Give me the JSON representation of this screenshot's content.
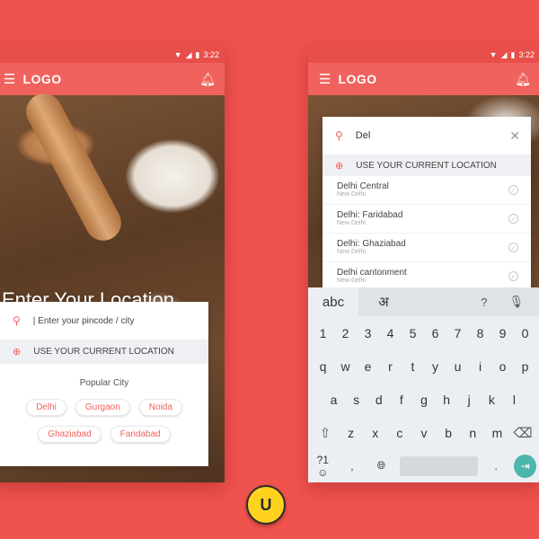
{
  "colors": {
    "background": "#f0524e",
    "appbar": "#f0625d",
    "accent": "#f0625d",
    "enter_key": "#4db6ac",
    "badge": "#ffd21f"
  },
  "status_bar": {
    "time": "3:22"
  },
  "app_bar": {
    "logo": "LOGO",
    "menu_icon": "hamburger-icon",
    "right_icon": "bell-icon"
  },
  "left_screen": {
    "hero_title": "Enter Your Location",
    "input_placeholder": "| Enter your pincode / city",
    "current_location_label": "USE YOUR CURRENT LOCATION",
    "popular_title": "Popular City",
    "cities": [
      "Delhi",
      "Gurgaon",
      "Noida",
      "Ghaziabad",
      "Faridabad"
    ]
  },
  "right_screen": {
    "search_value": "Del",
    "current_location_label": "USE YOUR CURRENT LOCATION",
    "suggestions": [
      {
        "name": "Delhi Central",
        "sub": "New Delhi"
      },
      {
        "name": "Delhi: Faridabad",
        "sub": "New Delhi"
      },
      {
        "name": "Delhi: Ghaziabad",
        "sub": "New Delhi"
      },
      {
        "name": "Delhi cantonment",
        "sub": "New Delhi"
      }
    ],
    "keyboard": {
      "tab_latin": "abc",
      "tab_hindi": "अ",
      "row_numbers": [
        "1",
        "2",
        "3",
        "4",
        "5",
        "6",
        "7",
        "8",
        "9",
        "0"
      ],
      "row_1": [
        "q",
        "w",
        "e",
        "r",
        "t",
        "y",
        "u",
        "i",
        "o",
        "p"
      ],
      "row_2": [
        "a",
        "s",
        "d",
        "f",
        "g",
        "h",
        "j",
        "k",
        "l"
      ],
      "row_3": [
        "z",
        "x",
        "c",
        "v",
        "b",
        "n",
        "m"
      ],
      "symbols_key": "?1☺",
      "comma_key": ",",
      "period_key": "."
    }
  },
  "badge": {
    "text": "U"
  }
}
